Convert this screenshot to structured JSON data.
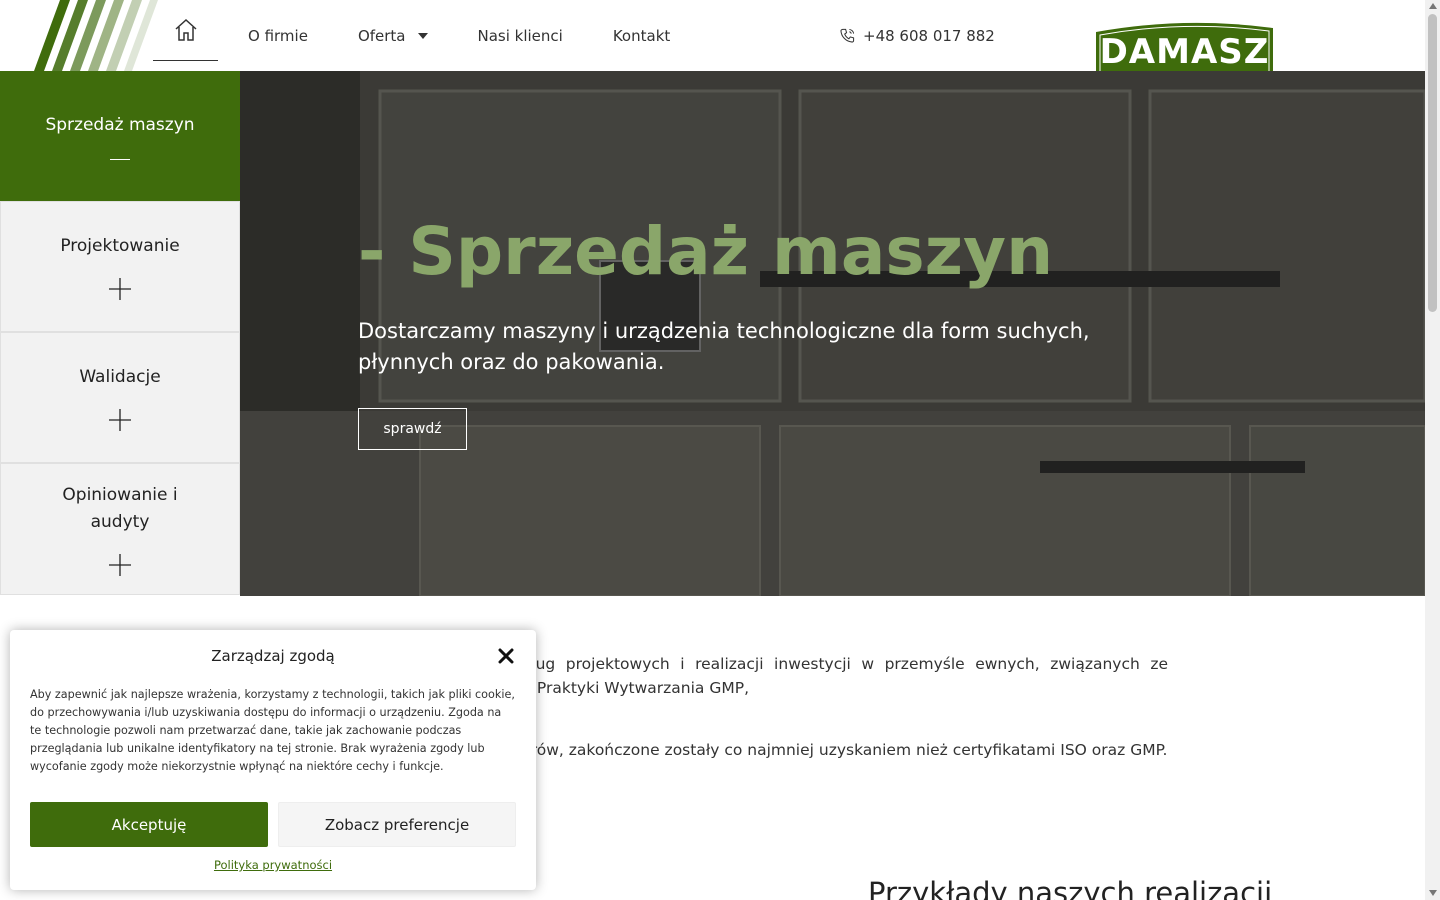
{
  "nav": {
    "home_label": "",
    "items": [
      {
        "label": "O firmie"
      },
      {
        "label": "Oferta"
      },
      {
        "label": "Nasi klienci"
      },
      {
        "label": "Kontakt"
      }
    ],
    "phone": "+48 608 017 882"
  },
  "logo": {
    "text": "DAMASZ",
    "color": "#3f6c0c"
  },
  "sidebar": {
    "items": [
      {
        "label": "Sprzedaż maszyn",
        "active": true
      },
      {
        "label": "Projektowanie",
        "active": false
      },
      {
        "label": "Walidacje",
        "active": false
      },
      {
        "label": "Opiniowanie i audyty",
        "active": false
      }
    ]
  },
  "hero": {
    "title": "- Sprzedaż maszyn",
    "subtitle": "Dostarczamy maszyny i urządzenia technologiczne dla form suchych, płynnych oraz do pakowania.",
    "button": "sprawdź"
  },
  "content": {
    "paragraph1": "ku, polską firmą w zakresie usług projektowych i realizacji inwestycji w przemyśle ewnych, związanych ze standardami jakościowymi Dobrej Praktyki Wytwarzania GMP,",
    "paragraph2": "towe, zrealizowane przez Inwestorów, zakończone zostały co najmniej uzyskaniem nież certyfikatami ISO oraz GMP.",
    "section_title": "Przykłady naszych realizacji"
  },
  "cookie": {
    "title": "Zarządzaj zgodą",
    "text": "Aby zapewnić jak najlepsze wrażenia, korzystamy z technologii, takich jak pliki cookie, do przechowywania i/lub uzyskiwania dostępu do informacji o urządzeniu. Zgoda na te technologie pozwoli nam przetwarzać dane, takie jak zachowanie podczas przeglądania lub unikalne identyfikatory na tej stronie. Brak wyrażenia zgody lub wycofanie zgody może niekorzystnie wpłynąć na niektóre cechy i funkcje.",
    "accept": "Akceptuję",
    "preferences": "Zobacz preferencje",
    "privacy": "Polityka prywatności"
  },
  "colors": {
    "brand": "#3f6c0c",
    "hero_title": "#8aa66a"
  },
  "icons": [
    "home-icon",
    "caret-down-icon",
    "phone-icon",
    "plus-icon",
    "close-icon"
  ]
}
